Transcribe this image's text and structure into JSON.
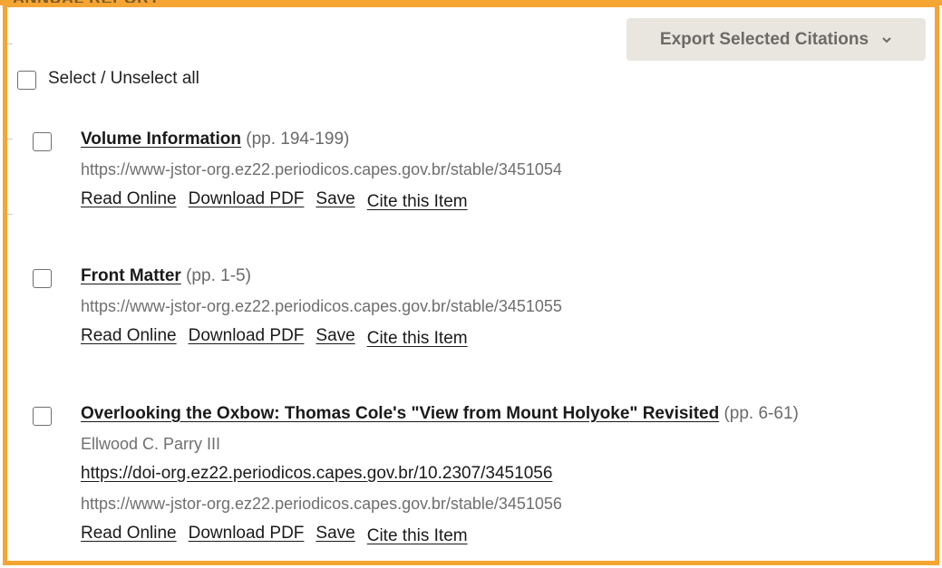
{
  "export": {
    "label": "Export Selected Citations",
    "icon": "chevron-down-icon"
  },
  "select_all": {
    "label": "Select / Unselect all"
  },
  "behind_heading": "ANNUAL REPORT",
  "items": [
    {
      "title": "Volume Information",
      "pages": "(pp. 194-199)",
      "stable_url": "https://www-jstor-org.ez22.periodicos.capes.gov.br/stable/3451054",
      "actions": {
        "read": "Read Online",
        "download": "Download PDF",
        "save": "Save",
        "cite": "Cite this Item"
      }
    },
    {
      "title": "Front Matter",
      "pages": "(pp. 1-5)",
      "stable_url": "https://www-jstor-org.ez22.periodicos.capes.gov.br/stable/3451055",
      "actions": {
        "read": "Read Online",
        "download": "Download PDF",
        "save": "Save",
        "cite": "Cite this Item"
      }
    },
    {
      "title": "Overlooking the Oxbow: Thomas Cole's \"View from Mount Holyoke\" Revisited",
      "pages": "(pp. 6-61)",
      "author": "Ellwood C. Parry III",
      "doi": "https://doi-org.ez22.periodicos.capes.gov.br/10.2307/3451056",
      "stable_url": "https://www-jstor-org.ez22.periodicos.capes.gov.br/stable/3451056",
      "actions": {
        "read": "Read Online",
        "download": "Download PDF",
        "save": "Save",
        "cite": "Cite this Item"
      }
    }
  ]
}
